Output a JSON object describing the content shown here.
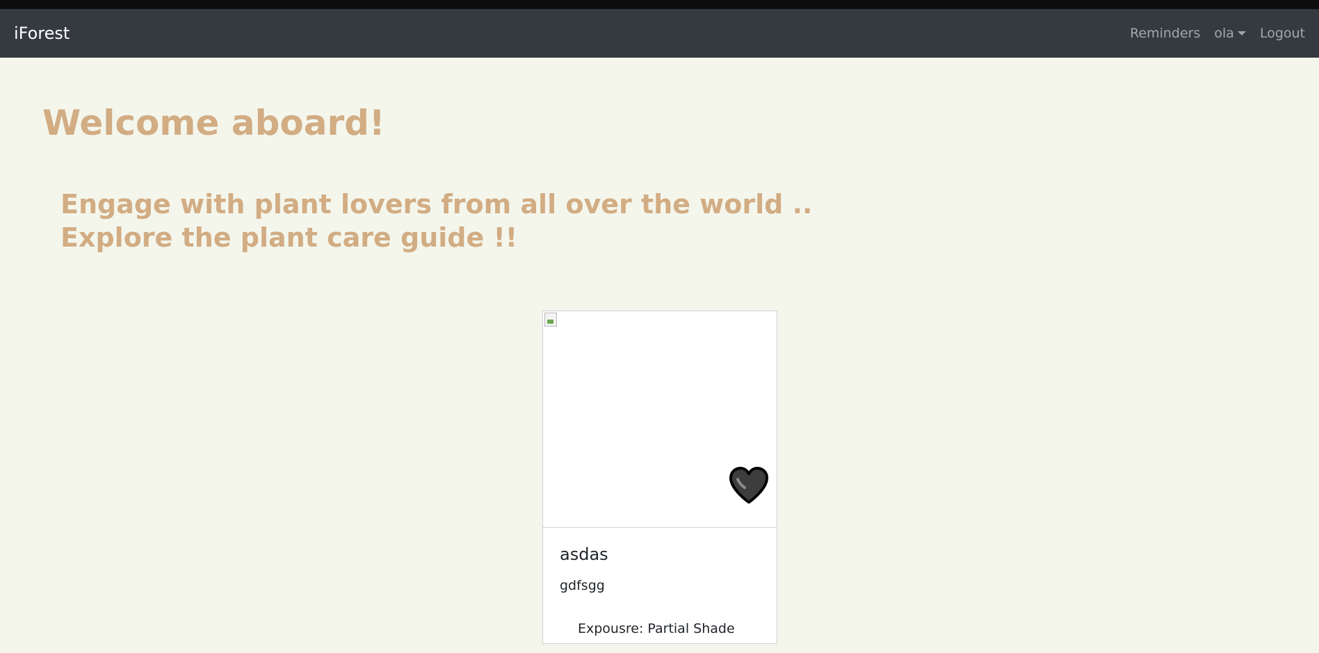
{
  "navbar": {
    "brand": "iForest",
    "links": {
      "reminders": "Reminders",
      "user": "ola",
      "logout": "Logout"
    }
  },
  "hero": {
    "title": "Welcome aboard!",
    "line1": "Engage with plant lovers from all over the world ..",
    "line2": "Explore the plant care guide !!"
  },
  "card": {
    "title": "asdas",
    "text": "gdfsgg",
    "exposure": "Expousre: Partial Shade"
  },
  "colors": {
    "background": "#f4f6ec",
    "navbar": "#343a40",
    "accent": "#d2ac83"
  },
  "icons": {
    "favorite": "heart-icon",
    "image": "broken-image-icon",
    "dropdown": "chevron-down-icon"
  }
}
